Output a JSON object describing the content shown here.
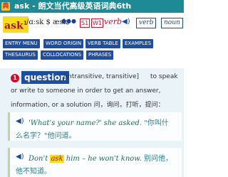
{
  "window": {
    "title": "ask - 朗文当代高级英语词典6th",
    "app_icon": "dictionary-app-icon"
  },
  "entry": {
    "headword": "ask",
    "homograph": "1",
    "pronunciation": "/ɑːsk $ æsk/",
    "frequency_dots": "●●●",
    "tags": [
      "S1",
      "W1"
    ],
    "part_of_speech": "verb",
    "word_links": [
      "verb",
      "noun"
    ],
    "buttons": [
      "ENTRY MENU",
      "WORD ORIGIN",
      "VERB TABLE",
      "EXAMPLES",
      "THESAURUS",
      "COLLOCATIONS",
      "PHRASES"
    ]
  },
  "sense": {
    "number": "1",
    "signpost": "question",
    "grammar": "[intransitive, transitive]",
    "definition_lines": [
      "to speak",
      "or write to someone in order to get an answer,",
      "information, or a solution 问，询问，打听，提问："
    ]
  },
  "examples": [
    {
      "en": "'What's your name?' she asked.",
      "zh_inline": "\"你叫什",
      "zh_line2": "么名字？\"他问道。"
    },
    {
      "en_before": "Don't",
      "highlight": "ask",
      "en_after": "him – he won't know.",
      "zh_inline": "别问他，",
      "zh_line2": "他不知道。"
    }
  ],
  "colors": {
    "titlebar": "#1e8a95",
    "highlight": "#f6dc1f",
    "accent_red": "#c8102e",
    "button_blue": "#1f4f9c"
  }
}
